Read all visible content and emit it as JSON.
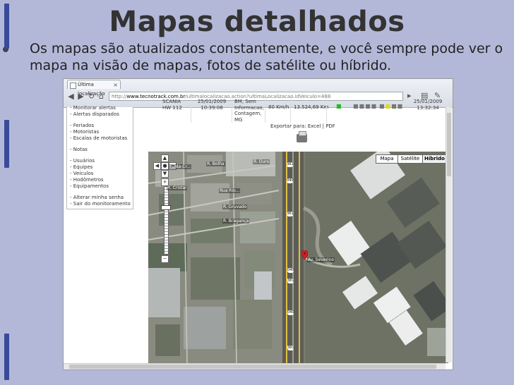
{
  "slide": {
    "title": "Mapas detalhados",
    "bullet": "Os mapas são atualizados constantemente, e você sempre pode ver o mapa na visão de mapas, fotos de satélite ou híbrido."
  },
  "browser": {
    "tab_title": "Última localização",
    "url_proto": "http://",
    "url_host": "www.tecnotrack.com.br",
    "url_path": "/ultimalocalizacao.action?ultimaLocalizacao.idVeiculo=488"
  },
  "menu": {
    "group1": [
      "- Alertas disparados"
    ],
    "group1_partial": "- Monitorar alertas",
    "group2": [
      "- Feriados",
      "- Motoristas",
      "- Escalas de motoristas"
    ],
    "group3": [
      "- Notas"
    ],
    "group4": [
      "- Usuários",
      "- Equipes",
      "- Veículos",
      "- Hodômetros",
      "- Equipamentos"
    ],
    "group5": [
      "- Alterar minha senha",
      "- Sair do monitoramento"
    ]
  },
  "record": {
    "vehicle_model": "SCANIA",
    "vehicle_plate": "HW 112",
    "date1": "25/01/2009",
    "time1": "10:39:08",
    "addr1": "ВМ, Sem",
    "addr2": "Informacao,",
    "addr3": "Contagem,",
    "addr4": "MG",
    "speed": "80 Km/h",
    "odometer": "13.524,69 Km",
    "date2": "25/01/2009",
    "time2": "13:32:34"
  },
  "export": {
    "label": "Exportar para:",
    "excel": "Excel",
    "separator": "|",
    "pdf": "PDF"
  },
  "map": {
    "types": [
      "Mapa",
      "Satélite",
      "Híbrido"
    ],
    "active_type": "Híbrido",
    "streets": [
      "R. Bolha",
      "R. Cristal",
      "R. Gruvado",
      "R. Bragança",
      "R. da Cr...",
      "Rua Rio...",
      "R. Ouro",
      "Av. Severino"
    ],
    "shields": [
      "381",
      "040",
      "381",
      "040",
      "381",
      "040",
      "381"
    ]
  },
  "colors": {
    "slide_bg": "#b4b8d8",
    "accent_bar": "#3a4a9a",
    "status_green": "#22bb22",
    "status_yellow": "#dddd22",
    "pin_red": "#d42020"
  }
}
